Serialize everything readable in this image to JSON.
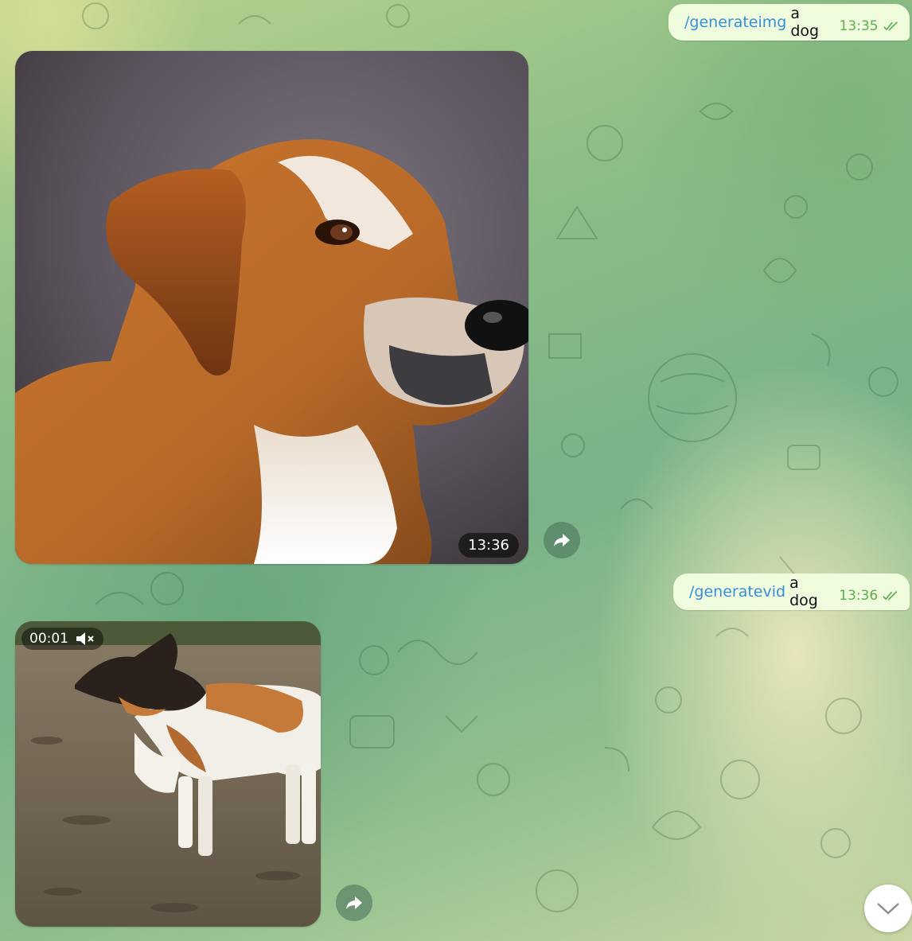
{
  "messages": [
    {
      "command": "/generateimg",
      "argument": "a dog",
      "time": "13:35",
      "status_icon": "double-check-icon"
    },
    {
      "type": "photo",
      "subject": "dog",
      "time": "13:36"
    },
    {
      "command": "/generatevid",
      "argument": "a dog",
      "time": "13:36",
      "status_icon": "double-check-icon"
    },
    {
      "type": "video",
      "subject": "dog",
      "duration": "00:01",
      "sound_icon": "muted-speaker-icon"
    }
  ],
  "controls": {
    "share_icon": "share-arrow-icon",
    "scroll_icon": "chevron-down-icon"
  },
  "colors": {
    "outgoing_bubble": "#effdde",
    "command_link": "#3a8ed6",
    "outgoing_time": "#5dae4c"
  }
}
